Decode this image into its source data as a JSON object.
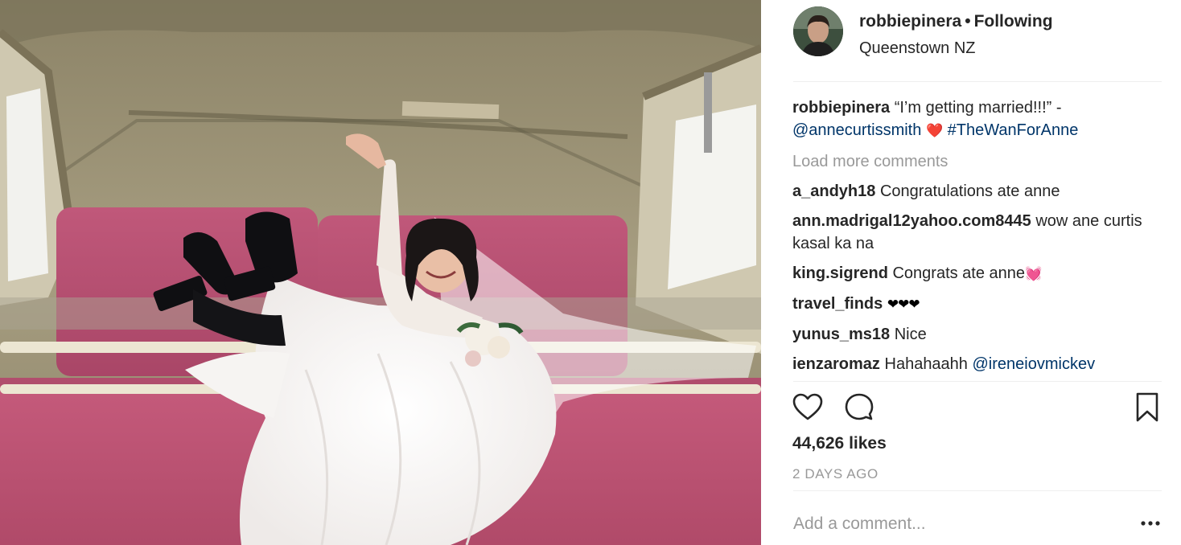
{
  "post": {
    "author": "robbiepinera",
    "follow_status": "Following",
    "location": "Queenstown NZ",
    "caption": {
      "username": "robbiepinera",
      "text": "“I’m getting married!!!” -",
      "mention": "@annecurtissmith",
      "emoji": "❤️",
      "hashtag": "#TheWanForAnne"
    },
    "load_more_label": "Load more comments",
    "comments": [
      {
        "username": "a_andyh18",
        "text": "Congratulations ate anne"
      },
      {
        "username": "ann.madrigal12yahoo.com8445",
        "text": "wow ane curtis kasal ka na"
      },
      {
        "username": "king.sigrend",
        "text": "Congrats ate anne",
        "emoji": "💓"
      },
      {
        "username": "travel_finds",
        "emoji": "❤❤❤"
      },
      {
        "username": "yunus_ms18",
        "text": "Nice"
      },
      {
        "username": "ienzaromaz",
        "text": "Hahahaahh",
        "mention": "@ireneiovmickev"
      }
    ],
    "likes": "44,626 likes",
    "timestamp": "2 DAYS AGO",
    "add_comment_placeholder": "Add a comment...",
    "more_label": "•••"
  },
  "icons": {
    "like": "heart-outline-icon",
    "comment": "speech-bubble-icon",
    "save": "bookmark-icon",
    "more": "ellipsis-icon"
  },
  "colors": {
    "link": "#003569",
    "muted": "#999999",
    "text": "#262626",
    "seat": "#b84a6a",
    "canopy": "#a49a7c"
  }
}
